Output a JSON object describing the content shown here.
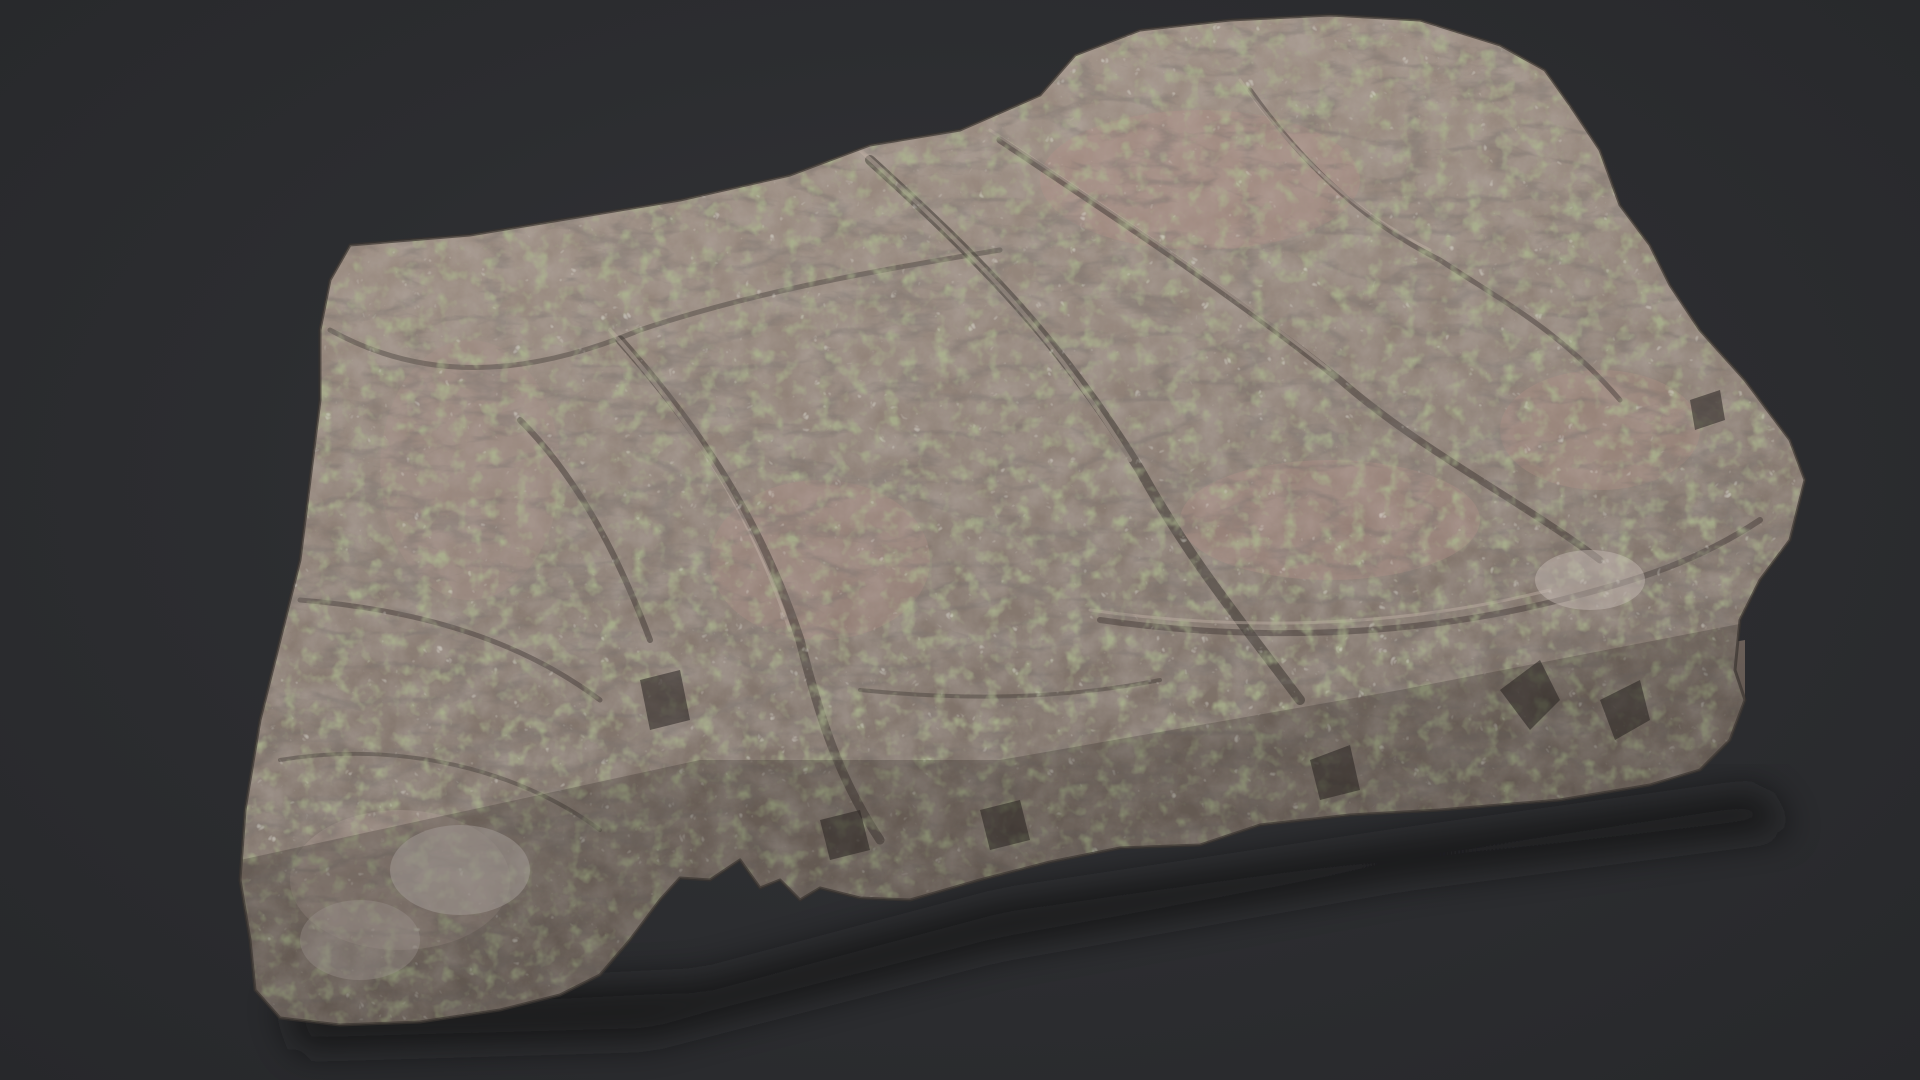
{
  "scene": {
    "subject": "rock-slab-3d-scan",
    "background_color": "#2c2d30",
    "rock_colors": {
      "base": "#8a7c72",
      "light": "#a89a8f",
      "pink": "#b08f86",
      "dark": "#4e4741",
      "shadow": "#1f1f21",
      "moss": "#6f7a4a",
      "lichen": "#c9cbb8"
    }
  }
}
